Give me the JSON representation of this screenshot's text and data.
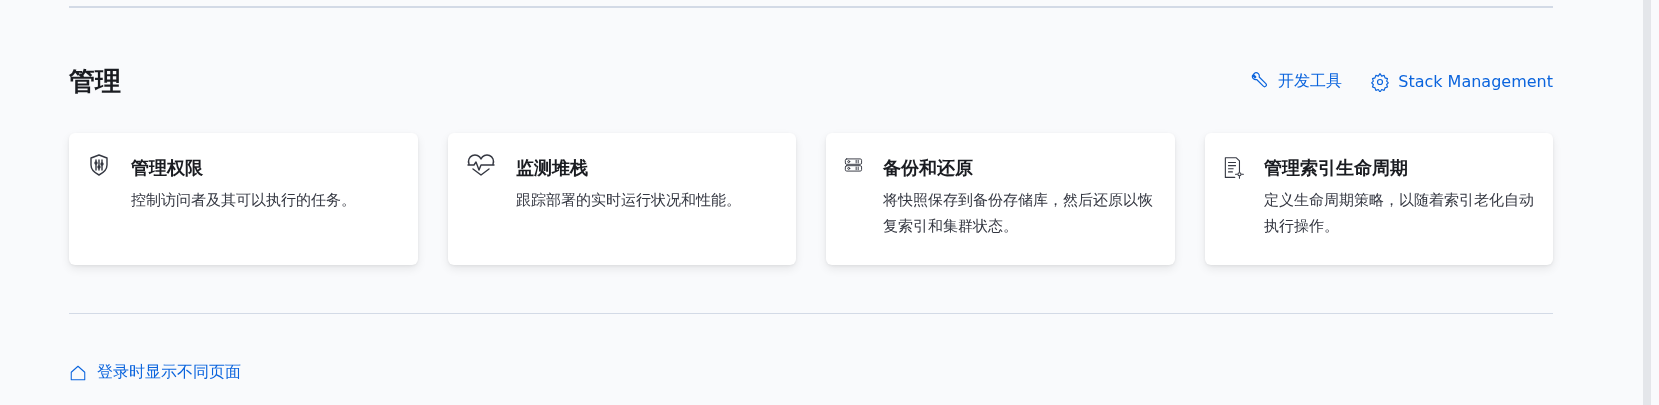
{
  "section": {
    "title": "管理",
    "links": [
      {
        "kind": "wrench",
        "label": "开发工具"
      },
      {
        "kind": "gear",
        "label": "Stack Management"
      }
    ],
    "cards": [
      {
        "kind": "shield",
        "title": "管理权限",
        "description": "控制访问者及其可以执行的任务。"
      },
      {
        "kind": "heartbeat",
        "title": "监测堆栈",
        "description": "跟踪部署的实时运行状况和性能。"
      },
      {
        "kind": "storage",
        "title": "备份和还原",
        "description": "将快照保存到备份存储库，然后还原以恢复索引和集群状态。"
      },
      {
        "kind": "document",
        "title": "管理索引生命周期",
        "description": "定义生命周期策略，以随着索引老化自动执行操作。"
      }
    ]
  },
  "footer_link": {
    "label": "登录时显示不同页面"
  }
}
